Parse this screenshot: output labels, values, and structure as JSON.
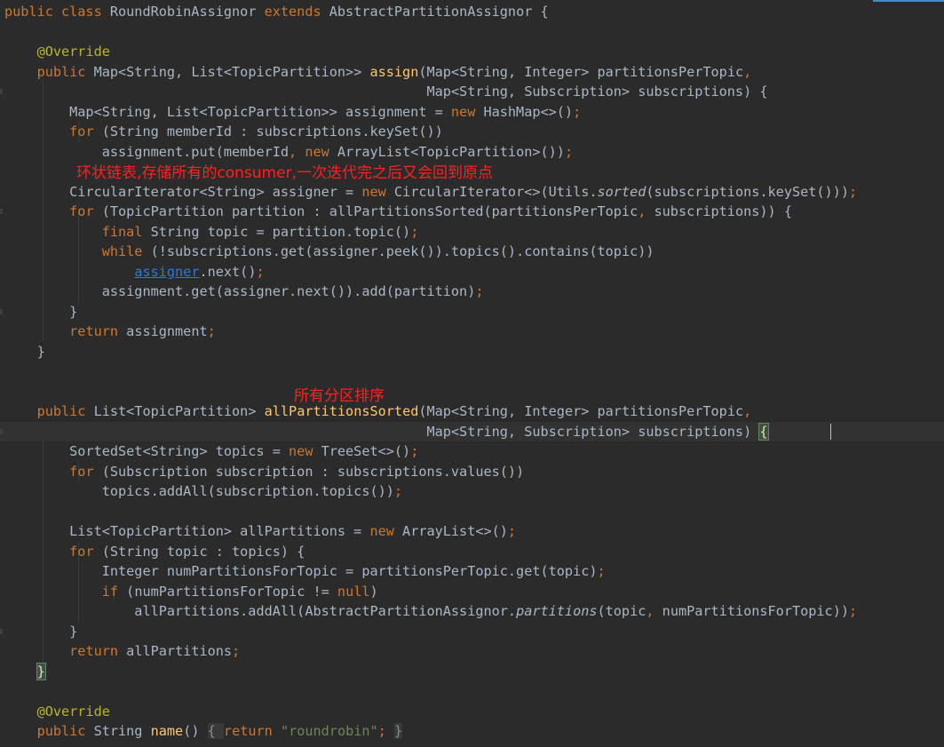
{
  "colors": {
    "background": "#2b2b2b",
    "keyword": "#cc7832",
    "annotation": "#bbb529",
    "method_declaration": "#ffc66d",
    "string": "#6a8759",
    "plain": "#a9b7c6",
    "link": "#287bde",
    "note": "#ff2020"
  },
  "code": [
    [
      [
        "kw",
        "public class "
      ],
      [
        "",
        "RoundRobinAssignor "
      ],
      [
        "kw",
        "extends "
      ],
      [
        "",
        "AbstractPartitionAssignor {"
      ]
    ],
    [],
    [
      [
        "",
        "    "
      ],
      [
        "ann",
        "@Override"
      ]
    ],
    [
      [
        "",
        "    "
      ],
      [
        "kw",
        "public "
      ],
      [
        "",
        "Map<String, List<TopicPartition>> "
      ],
      [
        "fn",
        "assign"
      ],
      [
        "",
        "(Map<String, Integer> partitionsPerTopic"
      ],
      [
        "kw",
        ","
      ]
    ],
    [
      [
        "",
        "                                                    Map<String, Subscription> subscriptions) {"
      ]
    ],
    [
      [
        "",
        "        Map<String, List<TopicPartition>> assignment = "
      ],
      [
        "kw",
        "new "
      ],
      [
        "",
        "HashMap<>()"
      ],
      [
        "kw",
        ";"
      ]
    ],
    [
      [
        "",
        "        "
      ],
      [
        "kw",
        "for "
      ],
      [
        "",
        "(String memberId : subscriptions.keySet())"
      ]
    ],
    [
      [
        "",
        "            assignment.put(memberId"
      ],
      [
        "kw",
        ", new "
      ],
      [
        "",
        "ArrayList<TopicPartition>())"
      ],
      [
        "kw",
        ";"
      ]
    ],
    [],
    [
      [
        "",
        "        CircularIterator<String> assigner = "
      ],
      [
        "kw",
        "new "
      ],
      [
        "",
        "CircularIterator<>(Utils."
      ],
      [
        "it",
        "sorted"
      ],
      [
        "",
        "(subscriptions.keySet()))"
      ],
      [
        "kw",
        ";"
      ]
    ],
    [
      [
        "",
        "        "
      ],
      [
        "kw",
        "for "
      ],
      [
        "",
        "(TopicPartition partition : allPartitionsSorted(partitionsPerTopic"
      ],
      [
        "kw",
        ", "
      ],
      [
        "",
        "subscriptions)) {"
      ]
    ],
    [
      [
        "",
        "            "
      ],
      [
        "kw",
        "final "
      ],
      [
        "",
        "String topic = partition.topic()"
      ],
      [
        "kw",
        ";"
      ]
    ],
    [
      [
        "",
        "            "
      ],
      [
        "kw",
        "while "
      ],
      [
        "",
        "(!subscriptions.get(assigner.peek()).topics().contains(topic))"
      ]
    ],
    [
      [
        "",
        "                "
      ],
      [
        "ul",
        "assigner"
      ],
      [
        "",
        ".next()"
      ],
      [
        "kw",
        ";"
      ]
    ],
    [
      [
        "",
        "            assignment.get(assigner.next()).add(partition)"
      ],
      [
        "kw",
        ";"
      ]
    ],
    [
      [
        "",
        "        }"
      ]
    ],
    [
      [
        "",
        "        "
      ],
      [
        "kw",
        "return "
      ],
      [
        "",
        "assignment"
      ],
      [
        "kw",
        ";"
      ]
    ],
    [
      [
        "",
        "    }"
      ]
    ],
    [],
    [],
    [
      [
        "",
        "    "
      ],
      [
        "kw",
        "public "
      ],
      [
        "",
        "List<TopicPartition> "
      ],
      [
        "fn",
        "allPartitionsSorted"
      ],
      [
        "",
        "(Map<String, Integer> partitionsPerTopic"
      ],
      [
        "kw",
        ","
      ]
    ],
    [
      [
        "",
        "                                                    Map<String, Subscription> subscriptions) "
      ],
      [
        "brace",
        "{"
      ]
    ],
    [
      [
        "",
        "        SortedSet<String> topics = "
      ],
      [
        "kw",
        "new "
      ],
      [
        "",
        "TreeSet<>()"
      ],
      [
        "kw",
        ";"
      ]
    ],
    [
      [
        "",
        "        "
      ],
      [
        "kw",
        "for "
      ],
      [
        "",
        "(Subscription subscription : subscriptions.values())"
      ]
    ],
    [
      [
        "",
        "            topics.addAll(subscription.topics())"
      ],
      [
        "kw",
        ";"
      ]
    ],
    [],
    [
      [
        "",
        "        List<TopicPartition> allPartitions = "
      ],
      [
        "kw",
        "new "
      ],
      [
        "",
        "ArrayList<>()"
      ],
      [
        "kw",
        ";"
      ]
    ],
    [
      [
        "",
        "        "
      ],
      [
        "kw",
        "for "
      ],
      [
        "",
        "(String topic : topics) {"
      ]
    ],
    [
      [
        "",
        "            Integer numPartitionsForTopic = partitionsPerTopic.get(topic)"
      ],
      [
        "kw",
        ";"
      ]
    ],
    [
      [
        "",
        "            "
      ],
      [
        "kw",
        "if "
      ],
      [
        "",
        "(numPartitionsForTopic != "
      ],
      [
        "kw",
        "null"
      ],
      [
        "",
        ")"
      ]
    ],
    [
      [
        "",
        "                allPartitions.addAll(AbstractPartitionAssignor."
      ],
      [
        "it",
        "partitions"
      ],
      [
        "",
        "(topic"
      ],
      [
        "kw",
        ", "
      ],
      [
        "",
        "numPartitionsForTopic))"
      ],
      [
        "kw",
        ";"
      ]
    ],
    [
      [
        "",
        "        }"
      ]
    ],
    [
      [
        "",
        "        "
      ],
      [
        "kw",
        "return "
      ],
      [
        "",
        "allPartitions"
      ],
      [
        "kw",
        ";"
      ]
    ],
    [
      [
        "",
        "    "
      ],
      [
        "brace",
        "}"
      ]
    ],
    [],
    [
      [
        "",
        "    "
      ],
      [
        "ann",
        "@Override"
      ]
    ],
    [
      [
        "",
        "    "
      ],
      [
        "kw",
        "public "
      ],
      [
        "",
        "String "
      ],
      [
        "fn",
        "name"
      ],
      [
        "",
        "() "
      ],
      [
        "fold",
        "{ "
      ],
      [
        "kw",
        "return "
      ],
      [
        "str",
        "\"roundrobin\""
      ],
      [
        "kw",
        "; "
      ],
      [
        "fold",
        "}"
      ]
    ]
  ],
  "notes": [
    "环状链表,存储所有的consumer,一次迭代完之后又会回到原点",
    "所有分区排序"
  ]
}
